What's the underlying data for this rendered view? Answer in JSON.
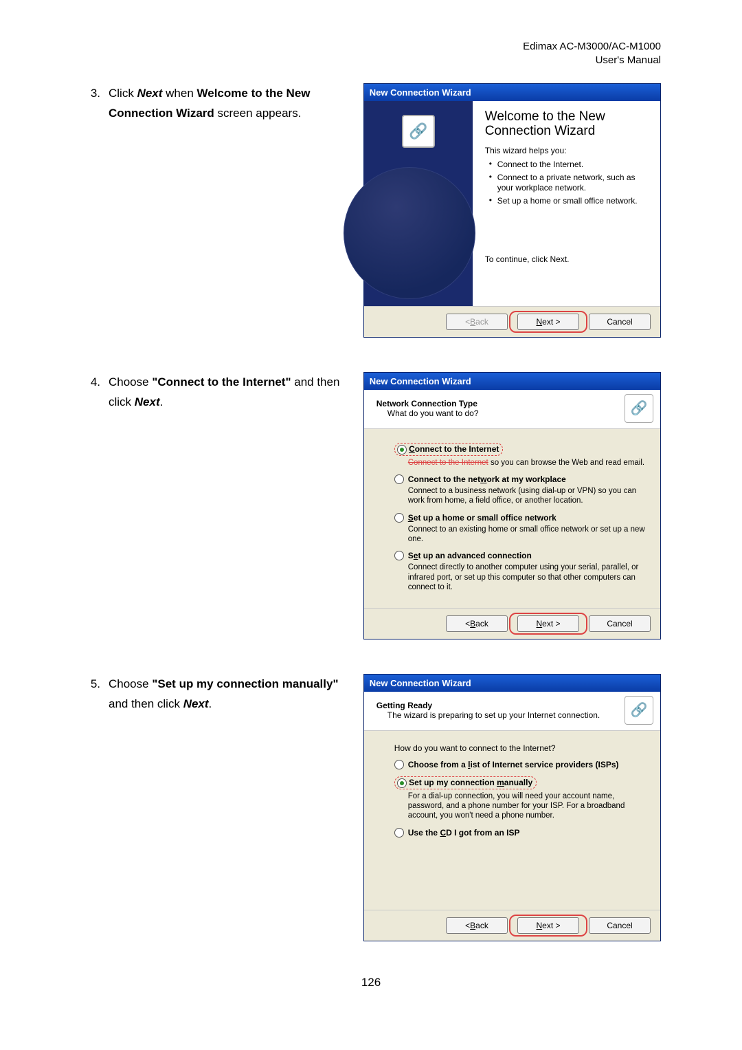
{
  "header": {
    "line1": "Edimax  AC-M3000/AC-M1000",
    "line2": "User's  Manual"
  },
  "steps": {
    "s3": {
      "num": "3.",
      "t1": "Click ",
      "next": "Next",
      "t2": " when ",
      "bold": "Welcome to the New Connection Wizard",
      "t3": " screen appears."
    },
    "s4": {
      "num": "4.",
      "t1": "Choose ",
      "q1": "\"Connect to the Internet\"",
      "t2": " and then click ",
      "next": "Next",
      "t3": "."
    },
    "s5": {
      "num": "5.",
      "t1": "Choose ",
      "q1": "\"Set up my connection manually\"",
      "t2": " and then click ",
      "next": "Next",
      "t3": "."
    }
  },
  "dlg": {
    "title": "New Connection Wizard",
    "welcome": {
      "title": "Welcome to the New Connection Wizard",
      "lead": "This wizard helps you:",
      "b1": "Connect to the Internet.",
      "b2": "Connect to a private network, such as your workplace network.",
      "b3": "Set up a home or small office network.",
      "cont": "To continue, click Next."
    },
    "step2": {
      "t1": "Network Connection Type",
      "t2": "What do you want to do?",
      "o1_pre": "C",
      "o1_rest": "onnect to the Internet",
      "o1d_strike": "Connect to the Internet",
      "o1d_rest": " so you can browse the Web and read email.",
      "o2_pre": "Connect to the net",
      "o2_u": "w",
      "o2_rest": "ork at my workplace",
      "o2d": "Connect to a business network (using dial-up or VPN) so you can work from home, a field office, or another location.",
      "o3_u": "S",
      "o3_rest": "et up a home or small office network",
      "o3d": "Connect to an existing home or small office network or set up a new one.",
      "o4_pre": "S",
      "o4_u": "e",
      "o4_rest": "t up an advanced connection",
      "o4d": "Connect directly to another computer using your serial, parallel, or infrared port, or set up this computer so that other computers can connect to it."
    },
    "step3": {
      "t1": "Getting Ready",
      "t2": "The wizard is preparing to set up your Internet connection.",
      "q": "How do you want to connect to the Internet?",
      "o1_pre": "Choose from a ",
      "o1_u": "l",
      "o1_mid": "ist of Internet service providers (ISPs)",
      "o2_pre": "Set up my connection ",
      "o2_u": "m",
      "o2_rest": "anually",
      "o2d": "For a dial-up connection, you will need your account name, password, and a phone number for your ISP. For a broadband account, you won't need a phone number.",
      "o3_pre": "Use the ",
      "o3_u": "C",
      "o3_rest": "D I got from an ISP"
    },
    "buttons": {
      "back_u": "B",
      "back_rest": "ack",
      "back_pre": "< ",
      "next_u": "N",
      "next_rest": "ext >",
      "cancel": "Cancel"
    }
  },
  "page_number": "126"
}
